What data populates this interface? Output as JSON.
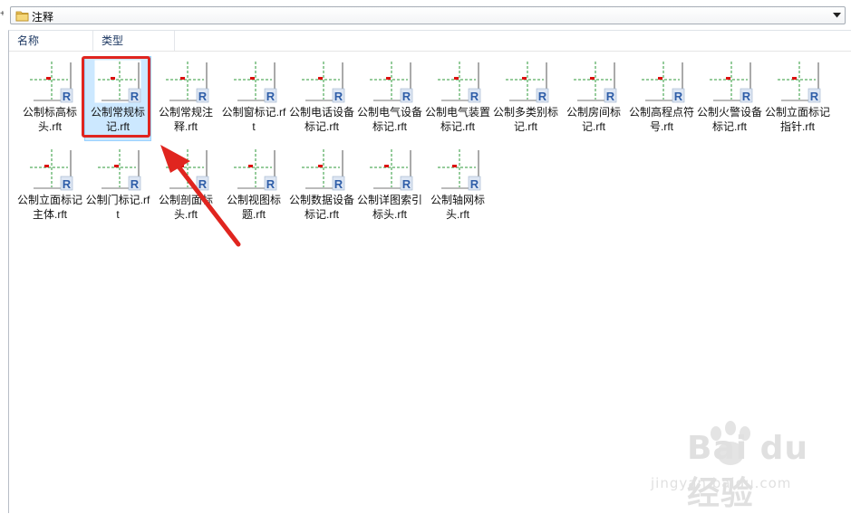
{
  "address_bar": {
    "folder_name": "注释",
    "icon": "folder-icon"
  },
  "columns": [
    {
      "label": "名称"
    },
    {
      "label": "类型"
    }
  ],
  "files": [
    {
      "name": "公制标高标头.rft",
      "selected": false
    },
    {
      "name": "公制常规标记.rft",
      "selected": true
    },
    {
      "name": "公制常规注释.rft",
      "selected": false
    },
    {
      "name": "公制窗标记.rft",
      "selected": false
    },
    {
      "name": "公制电话设备标记.rft",
      "selected": false
    },
    {
      "name": "公制电气设备标记.rft",
      "selected": false
    },
    {
      "name": "公制电气装置标记.rft",
      "selected": false
    },
    {
      "name": "公制多类别标记.rft",
      "selected": false
    },
    {
      "name": "公制房间标记.rft",
      "selected": false
    },
    {
      "name": "公制高程点符号.rft",
      "selected": false
    },
    {
      "name": "公制火警设备标记.rft",
      "selected": false
    },
    {
      "name": "公制立面标记指针.rft",
      "selected": false
    },
    {
      "name": "公制立面标记主体.rft",
      "selected": false
    },
    {
      "name": "公制门标记.rft",
      "selected": false
    },
    {
      "name": "公制剖面标头.rft",
      "selected": false
    },
    {
      "name": "公制视图标题.rft",
      "selected": false
    },
    {
      "name": "公制数据设备标记.rft",
      "selected": false
    },
    {
      "name": "公制详图索引标头.rft",
      "selected": false
    },
    {
      "name": "公制轴网标头.rft",
      "selected": false
    }
  ],
  "watermark": {
    "brand": "Bai du 经验",
    "url": "jingyan.baidu.com"
  },
  "colors": {
    "selection": "#cce8ff",
    "highlight": "#e0251f",
    "guide_line": "#2e9a3a",
    "revit_badge": "#2f5ea8"
  }
}
